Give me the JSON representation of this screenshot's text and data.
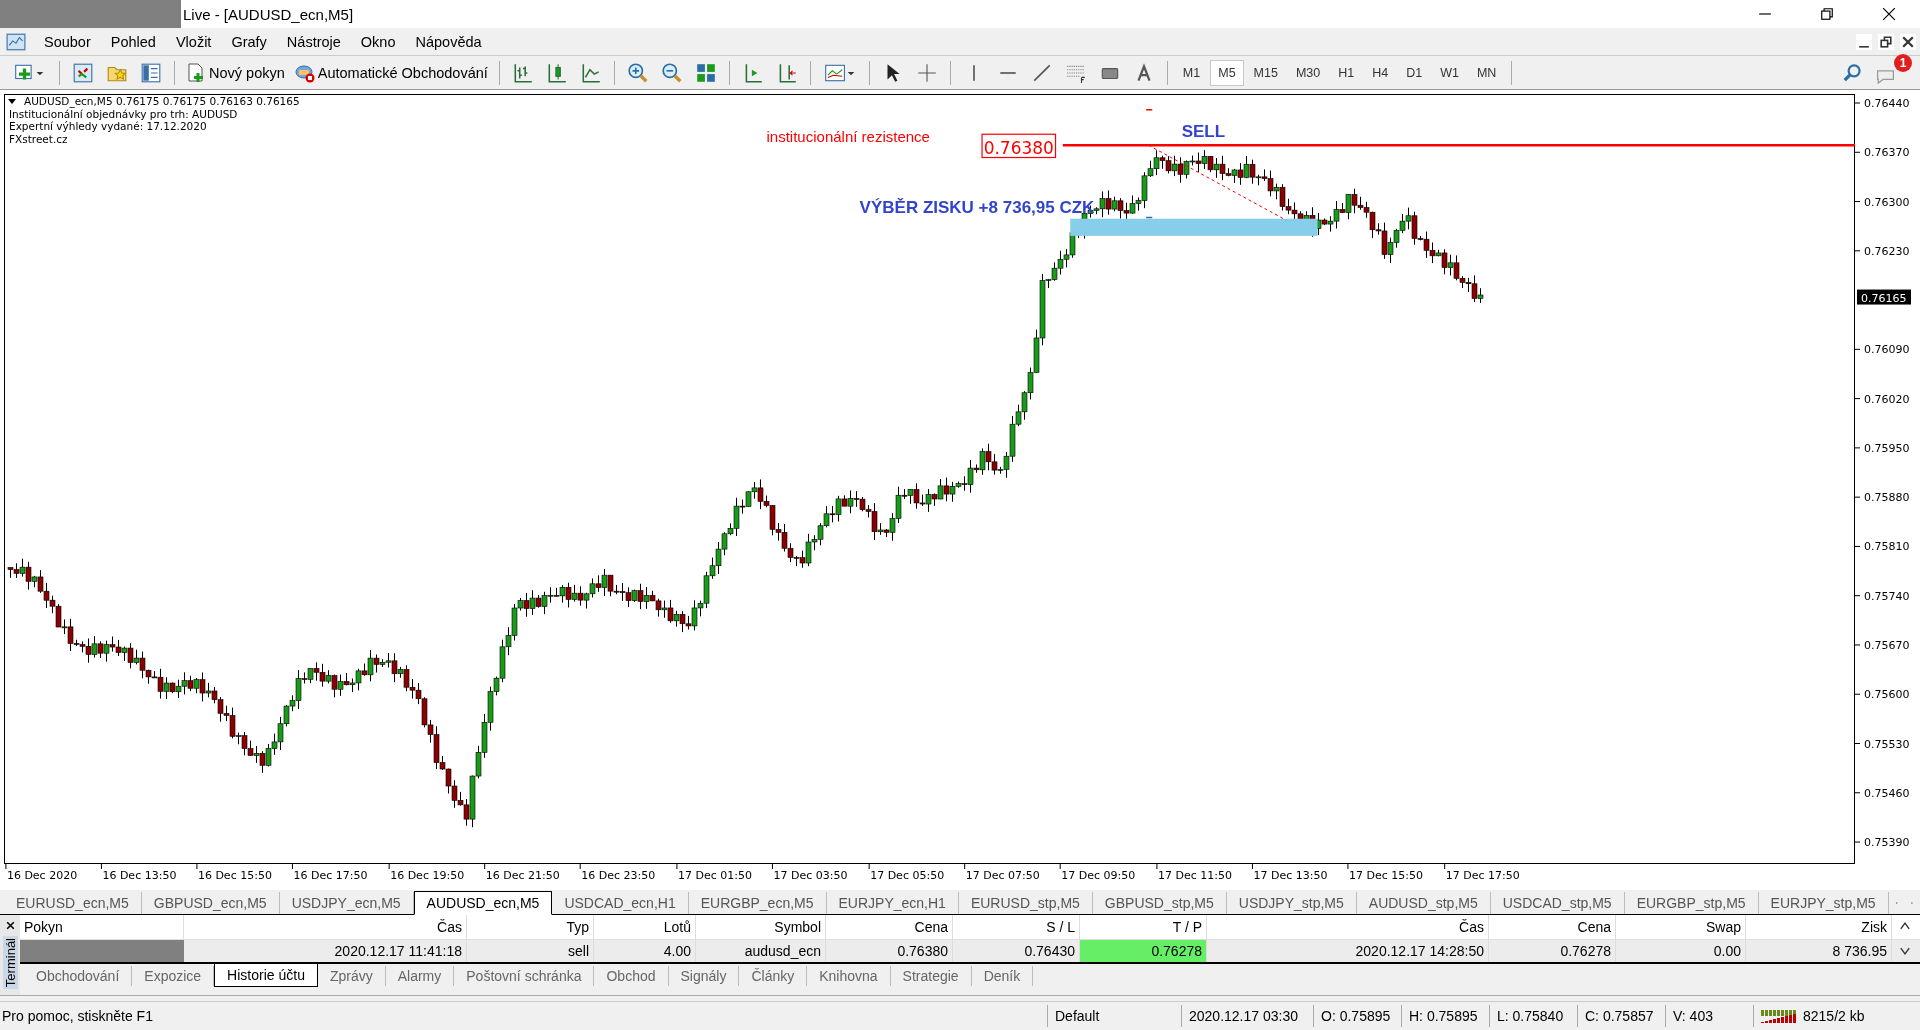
{
  "window": {
    "title": "Live - [AUDUSD_ecn,M5]"
  },
  "menu": [
    "Soubor",
    "Pohled",
    "Vložit",
    "Grafy",
    "Nástroje",
    "Okno",
    "Nápověda"
  ],
  "toolbar": {
    "new_order": "Nový pokyn",
    "auto_trading": "Automatické Obchodování",
    "notifications": "1",
    "timeframes": [
      {
        "label": "M1",
        "selected": false
      },
      {
        "label": "M5",
        "selected": true
      },
      {
        "label": "M15",
        "selected": false
      },
      {
        "label": "M30",
        "selected": false
      },
      {
        "label": "H1",
        "selected": false
      },
      {
        "label": "H4",
        "selected": false
      },
      {
        "label": "D1",
        "selected": false
      },
      {
        "label": "W1",
        "selected": false
      },
      {
        "label": "MN",
        "selected": false
      }
    ]
  },
  "chart": {
    "info": [
      "AUDUSD_ecn,M5  0.76175 0.76175 0.76163 0.76165",
      "Institucionální objednávky pro trh: AUDUSD",
      "Expertní výhledy vydané: 17.12.2020",
      "FXstreet.cz"
    ],
    "price_axis": [
      "0.76440",
      "0.76370",
      "0.76300",
      "0.76230",
      "0.76090",
      "0.76020",
      "0.75950",
      "0.75880",
      "0.75810",
      "0.75740",
      "0.75670",
      "0.75600",
      "0.75530",
      "0.75460",
      "0.75390"
    ],
    "current_price": "0.76165",
    "time_axis": [
      "16 Dec 2020",
      "16 Dec 13:50",
      "16 Dec 15:50",
      "16 Dec 17:50",
      "16 Dec 19:50",
      "16 Dec 21:50",
      "16 Dec 23:50",
      "17 Dec 01:50",
      "17 Dec 03:50",
      "17 Dec 05:50",
      "17 Dec 07:50",
      "17 Dec 09:50",
      "17 Dec 11:50",
      "17 Dec 13:50",
      "17 Dec 15:50",
      "17 Dec 17:50"
    ],
    "resistance_label": "institucionální rezistence",
    "resistance_price": "0.76380",
    "sell_label": "SELL",
    "profit_label": "VÝBĚR ZISKU +8 736,95 CZK"
  },
  "chart_tabs": [
    {
      "label": "EURUSD_ecn,M5",
      "selected": false
    },
    {
      "label": "GBPUSD_ecn,M5",
      "selected": false
    },
    {
      "label": "USDJPY_ecn,M5",
      "selected": false
    },
    {
      "label": "AUDUSD_ecn,M5",
      "selected": true
    },
    {
      "label": "USDCAD_ecn,H1",
      "selected": false
    },
    {
      "label": "EURGBP_ecn,M5",
      "selected": false
    },
    {
      "label": "EURJPY_ecn,H1",
      "selected": false
    },
    {
      "label": "EURUSD_stp,M5",
      "selected": false
    },
    {
      "label": "GBPUSD_stp,M5",
      "selected": false
    },
    {
      "label": "USDJPY_stp,M5",
      "selected": false
    },
    {
      "label": "AUDUSD_stp,M5",
      "selected": false
    },
    {
      "label": "USDCAD_stp,M5",
      "selected": false
    },
    {
      "label": "EURGBP_stp,M5",
      "selected": false
    },
    {
      "label": "EURJPY_stp,M5",
      "selected": false
    }
  ],
  "terminal": {
    "title": "Terminál",
    "order_column": "Pokyn",
    "columns": [
      "Čas",
      "Typ",
      "Lotů",
      "Symbol",
      "Cena",
      "S / L",
      "T / P",
      "Čas",
      "Cena",
      "Swap",
      "Zisk"
    ],
    "rows": [
      {
        "cells": [
          "2020.12.17 11:41:18",
          "sell",
          "4.00",
          "audusd_ecn",
          "0.76380",
          "0.76430",
          "0.76278",
          "2020.12.17 14:28:50",
          "0.76278",
          "0.00",
          "8 736.95"
        ],
        "tp_highlighted": true
      }
    ],
    "tabs": [
      {
        "label": "Obchodování",
        "selected": false
      },
      {
        "label": "Expozice",
        "selected": false
      },
      {
        "label": "Historie účtu",
        "selected": true
      },
      {
        "label": "Zprávy",
        "selected": false
      },
      {
        "label": "Alarmy",
        "selected": false
      },
      {
        "label": "Poštovní schránka",
        "selected": false
      },
      {
        "label": "Obchod",
        "selected": false
      },
      {
        "label": "Signály",
        "selected": false
      },
      {
        "label": "Články",
        "selected": false
      },
      {
        "label": "Knihovna",
        "selected": false
      },
      {
        "label": "Strategie",
        "selected": false
      },
      {
        "label": "Deník",
        "selected": false
      }
    ]
  },
  "status_bar": {
    "help": "Pro pomoc, stiskněte F1",
    "profile": "Default",
    "time": "2020.12.17 03:30",
    "open": "O: 0.75895",
    "high": "H: 0.75895",
    "low": "L: 0.75840",
    "close": "C: 0.75857",
    "volume": "V: 403",
    "traffic": "8215/2 kb"
  }
}
